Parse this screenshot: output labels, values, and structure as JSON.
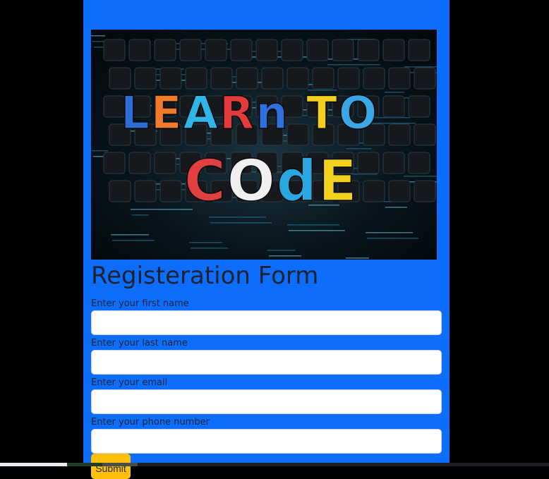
{
  "banner": {
    "line1": "LEARn TO",
    "line2": "COdE",
    "line1_colors": [
      "#2b6fd6",
      "#f07b2a",
      "#2fb5e8",
      "#e23b3b",
      "#2f6fde",
      "#f2cf1e",
      "#3aa7e4"
    ],
    "line2_colors": [
      "#e04040",
      "#f0f0f0",
      "#2aa7e0",
      "#f2d21c"
    ]
  },
  "form": {
    "title": "Registeration Form",
    "fields": [
      {
        "label": "Enter your first name",
        "value": ""
      },
      {
        "label": "Enter your last name",
        "value": ""
      },
      {
        "label": "Enter your email",
        "value": ""
      },
      {
        "label": "Enter your phone number",
        "value": ""
      }
    ],
    "submit_label": "Submit"
  },
  "colors": {
    "page_background": "#000000",
    "panel": "#0d6efd",
    "submit": "#ffc107"
  }
}
